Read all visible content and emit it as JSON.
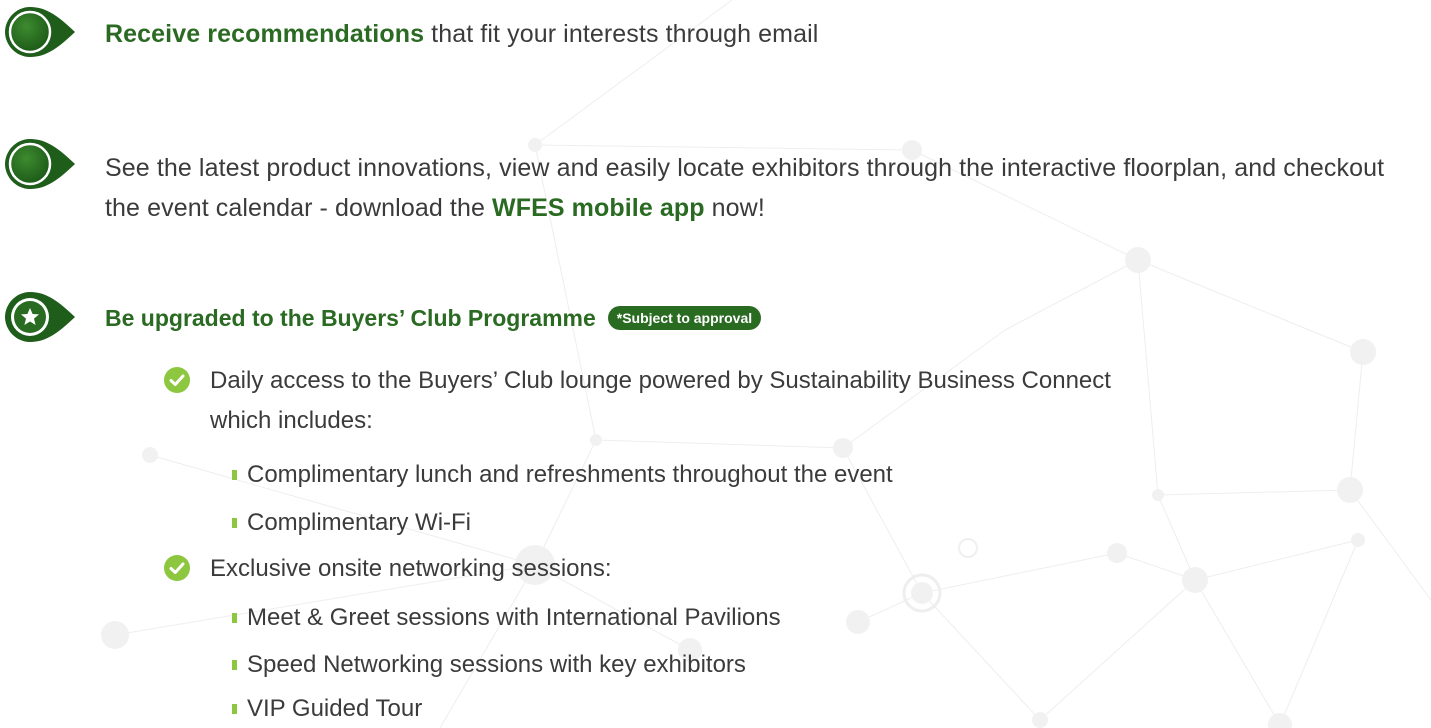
{
  "item1": {
    "highlight": "Receive recommendations",
    "rest": " that fit your interests through email"
  },
  "item2": {
    "line_start": "See the latest product innovations, view and easily locate exhibitors through the interactive floorplan, and checkout the event calendar - download the ",
    "highlight": "WFES mobile app",
    "line_end": " now!"
  },
  "item3": {
    "heading": "Be upgraded to the Buyers’ Club Programme",
    "badge": "*Subject to approval",
    "icon": "star-icon",
    "benefits": [
      {
        "text_line1": "Daily access to the Buyers’ Club lounge powered by Sustainability Business Connect",
        "text_line2": "which includes:",
        "sub": [
          "Complimentary lunch and refreshments throughout the event",
          "Complimentary Wi-Fi"
        ]
      },
      {
        "text_line1": "Exclusive onsite networking sessions:",
        "sub": [
          "Meet & Greet sessions with International Pavilions",
          "Speed Networking sessions with key exhibitors",
          "VIP Guided Tour"
        ]
      }
    ]
  },
  "colors": {
    "accent_green": "#2a6a22",
    "check_green": "#8dc63f",
    "text": "#3b3b3b"
  }
}
